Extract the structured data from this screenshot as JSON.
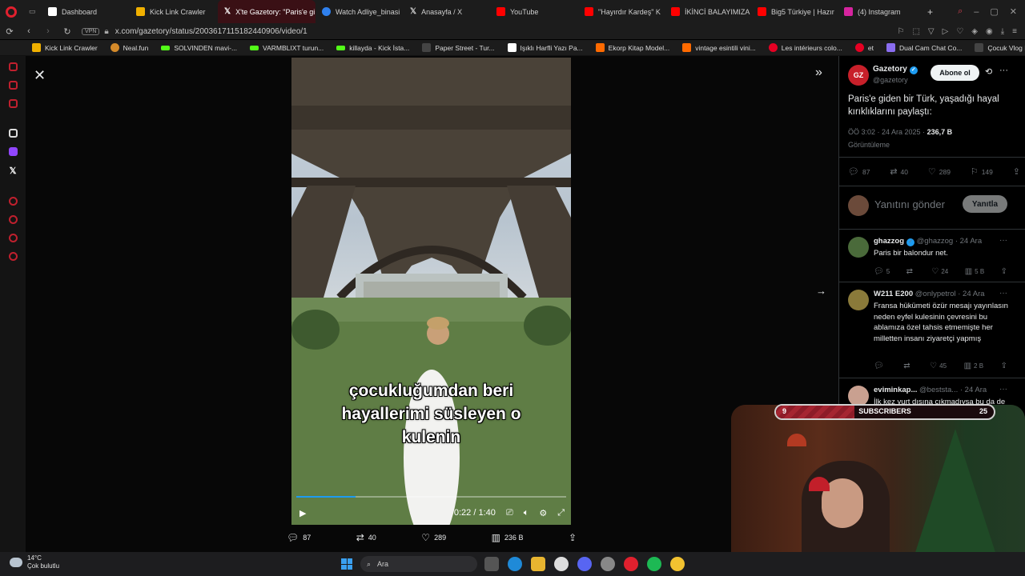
{
  "tabs": [
    {
      "label": "Dashboard",
      "color": "#ffffff"
    },
    {
      "label": "Kick Link Crawler",
      "color": "#f0b000"
    },
    {
      "label": "X'te Gazetory: \"Paris'e gi",
      "color": "#ffffff",
      "active": true
    },
    {
      "label": "Watch Adliye_binasi",
      "color": "#2f80ed"
    },
    {
      "label": "Anasayfa / X",
      "color": "#ffffff"
    },
    {
      "label": "YouTube",
      "color": "#ff0000"
    },
    {
      "label": "\"Hayırdır Kardeş\" K",
      "color": "#ff0000"
    },
    {
      "label": "İKİNCİ BALAYIMIZA",
      "color": "#ff0000"
    },
    {
      "label": "Big5 Türkiye | Hazır",
      "color": "#ff0000"
    },
    {
      "label": "(4) Instagram",
      "color": "#d6249f"
    }
  ],
  "url": "x.com/gazetory/status/2003617115182440906/video/1",
  "vpn_label": "VPN",
  "bookmarks": [
    {
      "label": "Kick Link Crawler",
      "color": "#f0b000"
    },
    {
      "label": "Neal.fun",
      "color": "#d48a2a"
    },
    {
      "label": "SOLVINDEN mavi-...",
      "color": "#53fc18"
    },
    {
      "label": "VARMBLIXT turun...",
      "color": "#53fc18"
    },
    {
      "label": "killayda - Kick İsta...",
      "color": "#53fc18"
    },
    {
      "label": "Paper Street - Tur...",
      "color": "#444444"
    },
    {
      "label": "Işıklı Harfli Yazı Pa...",
      "color": "#ffffff"
    },
    {
      "label": "Ekorp Kitap Model...",
      "color": "#ff6a00"
    },
    {
      "label": "vintage esintili vini...",
      "color": "#ff6a00"
    },
    {
      "label": "Les intérieurs colo...",
      "color": "#e60023"
    },
    {
      "label": "et",
      "color": "#e60023"
    },
    {
      "label": "Dual Cam Chat Co...",
      "color": "#8a6df0"
    },
    {
      "label": "Çocuk Vlog Bingosu",
      "color": "#444444"
    }
  ],
  "video": {
    "caption_lines": [
      "çocukluğumdan beri",
      "hayallerimi süsleyen o",
      "kulenin"
    ],
    "current_time": "0:22",
    "separator": "/",
    "duration": "1:40",
    "progress_fraction": 0.22
  },
  "video_actions": {
    "replies": "87",
    "reposts": "40",
    "likes": "289",
    "views": "236 B"
  },
  "account": {
    "avatar_text": "GZ",
    "name": "Gazetory",
    "handle": "@gazetory",
    "follow_label": "Abone ol"
  },
  "tweet": {
    "text": "Paris'e giden bir Türk, yaşadığı hayal kırıklıklarını paylaştı:",
    "time": "ÖÖ 3:02 · 24 Ara 2025 ·",
    "views_count": "236,7 B",
    "views_label": "Görüntüleme",
    "stats": {
      "replies": "87",
      "reposts": "40",
      "likes": "289",
      "bookmarks": "149"
    }
  },
  "reply_box": {
    "placeholder": "Yanıtını gönder",
    "button": "Yanıtla"
  },
  "comments": [
    {
      "name": "ghazzog",
      "handle": "@ghazzog",
      "date": "· 24 Ara",
      "text": "Paris bir balondur net.",
      "replies": "5",
      "reposts": "",
      "likes": "24",
      "views": "5 B",
      "avatar_color": "#4a6a3a"
    },
    {
      "name": "W211 E200",
      "handle": "@onlypetrol",
      "date": "· 24 Ara",
      "text": "Fransa hükümeti özür mesajı yayınlasın neden eyfel kulesinin çevresini bu ablamıza özel tahsis etmemişte her milletten insanı ziyaretçi yapmış",
      "replies": "",
      "reposts": "",
      "likes": "45",
      "views": "2 B",
      "avatar_color": "#8a7a3a"
    },
    {
      "name": "eviminkap...",
      "handle": "@beststa...",
      "date": "· 24 Ara",
      "text": "İlk kez yurt dışına çıkmadıysa bu da de",
      "avatar_color": "#c9a090"
    }
  ],
  "subscriber_goal": {
    "current": "9",
    "label": "SUBSCRIBERS",
    "target": "25",
    "fraction": 0.36
  },
  "taskbar": {
    "temperature": "14°C",
    "weather": "Çok bulutlu",
    "search_label": "Ara"
  }
}
